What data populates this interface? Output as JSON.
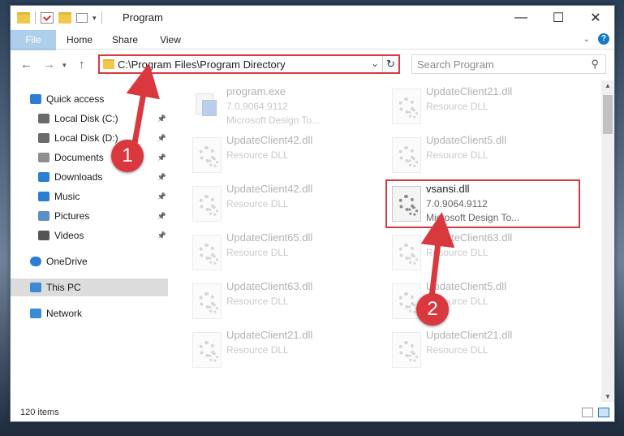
{
  "window": {
    "title": "Program",
    "buttons": {
      "minimize": "—",
      "maximize": "☐",
      "close": "✕"
    }
  },
  "ribbon": {
    "tabs": [
      "File",
      "Home",
      "Share",
      "View"
    ],
    "help": "?"
  },
  "address": {
    "path": "C:\\Program Files\\Program Directory",
    "search_placeholder": "Search Program"
  },
  "nav": {
    "items": [
      {
        "label": "Quick access",
        "icon": "star-icon",
        "pinned": false
      },
      {
        "label": "Local Disk (C:)",
        "icon": "drive-icon",
        "pinned": true
      },
      {
        "label": "Local Disk (D:)",
        "icon": "drive-icon",
        "pinned": true
      },
      {
        "label": "Documents",
        "icon": "documents-icon",
        "pinned": true
      },
      {
        "label": "Downloads",
        "icon": "downloads-icon",
        "pinned": true
      },
      {
        "label": "Music",
        "icon": "music-icon",
        "pinned": true
      },
      {
        "label": "Pictures",
        "icon": "pictures-icon",
        "pinned": true
      },
      {
        "label": "Videos",
        "icon": "videos-icon",
        "pinned": true
      },
      {
        "label": "OneDrive",
        "icon": "cloud-icon",
        "pinned": false
      },
      {
        "label": "This PC",
        "icon": "computer-icon",
        "pinned": false,
        "selected": true
      },
      {
        "label": "Network",
        "icon": "network-icon",
        "pinned": false
      }
    ]
  },
  "files": [
    {
      "name": "program.exe",
      "version": "7.0.9064.9112",
      "desc": "Microsoft Design To...",
      "type": "exe"
    },
    {
      "name": "UpdateClient21.dll",
      "version": "Resource DLL",
      "desc": "",
      "type": "dll"
    },
    {
      "name": "UpdateClient42.dll",
      "version": "Resource DLL",
      "desc": "",
      "type": "dll"
    },
    {
      "name": "UpdateClient5.dll",
      "version": "Resource DLL",
      "desc": "",
      "type": "dll"
    },
    {
      "name": "UpdateClient42.dll",
      "version": "Resource DLL",
      "desc": "",
      "type": "dll"
    },
    {
      "name": "vsansi.dll",
      "version": "7.0.9064.9112",
      "desc": "Microsoft Design To...",
      "type": "dll",
      "focus": true
    },
    {
      "name": "UpdateClient65.dll",
      "version": "Resource DLL",
      "desc": "",
      "type": "dll"
    },
    {
      "name": "UpdateClient63.dll",
      "version": "Resource DLL",
      "desc": "",
      "type": "dll"
    },
    {
      "name": "UpdateClient63.dll",
      "version": "Resource DLL",
      "desc": "",
      "type": "dll"
    },
    {
      "name": "UpdateClient5.dll",
      "version": "Resource DLL",
      "desc": "",
      "type": "dll"
    },
    {
      "name": "UpdateClient21.dll",
      "version": "Resource DLL",
      "desc": "",
      "type": "dll"
    },
    {
      "name": "UpdateClient21.dll",
      "version": "Resource DLL",
      "desc": "",
      "type": "dll"
    }
  ],
  "status": {
    "count": "120 items"
  },
  "annotations": {
    "step1": "1",
    "step2": "2",
    "color": "#d9383f"
  }
}
